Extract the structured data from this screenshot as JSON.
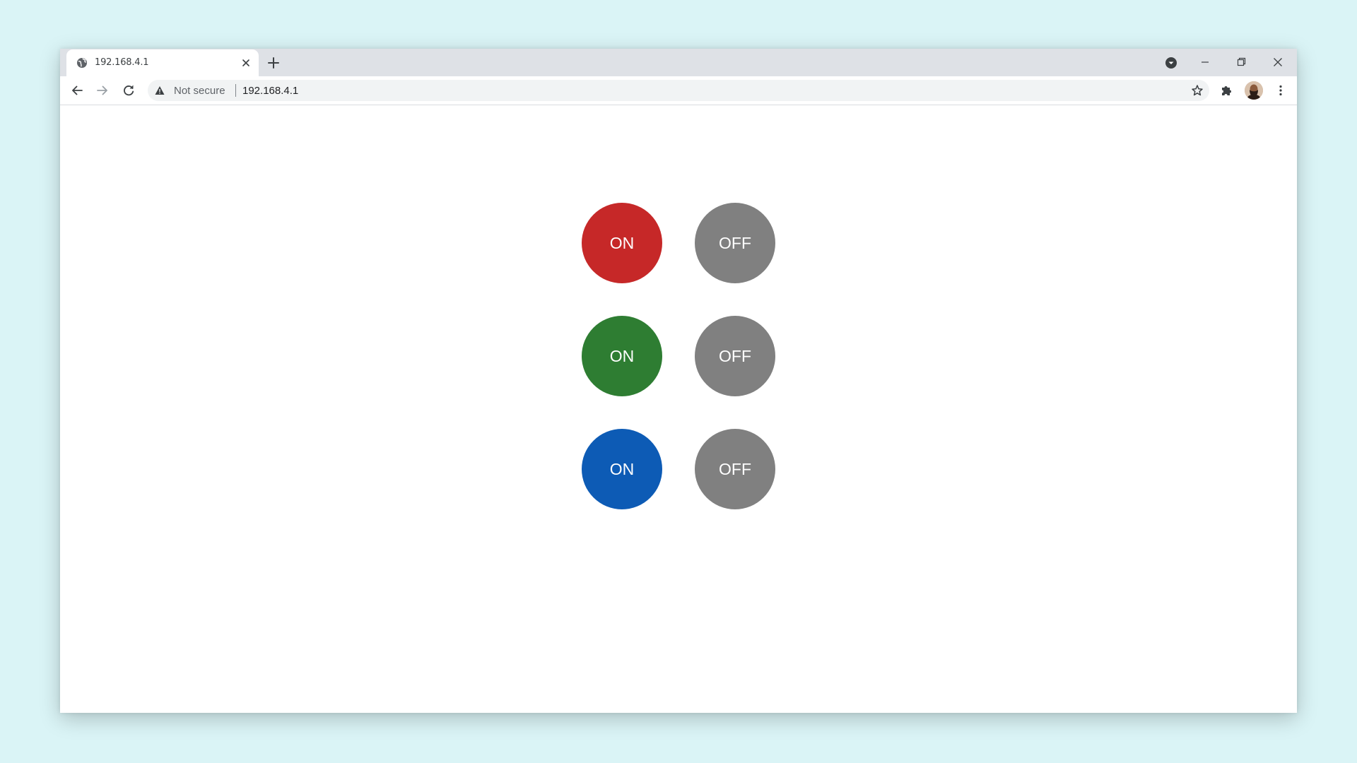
{
  "browser": {
    "tab": {
      "title": "192.168.4.1",
      "favicon": "globe-icon"
    },
    "address_bar": {
      "security_label": "Not secure",
      "url": "192.168.4.1"
    }
  },
  "controls": {
    "rows": [
      {
        "on_label": "ON",
        "off_label": "OFF",
        "on_color": "#c62828",
        "off_color": "#808080"
      },
      {
        "on_label": "ON",
        "off_label": "OFF",
        "on_color": "#2e7d32",
        "off_color": "#808080"
      },
      {
        "on_label": "ON",
        "off_label": "OFF",
        "on_color": "#0d5bb5",
        "off_color": "#808080"
      }
    ]
  },
  "colors": {
    "background": "#daf4f6",
    "tabstrip": "#dee1e6",
    "omnibox": "#f1f3f4"
  }
}
